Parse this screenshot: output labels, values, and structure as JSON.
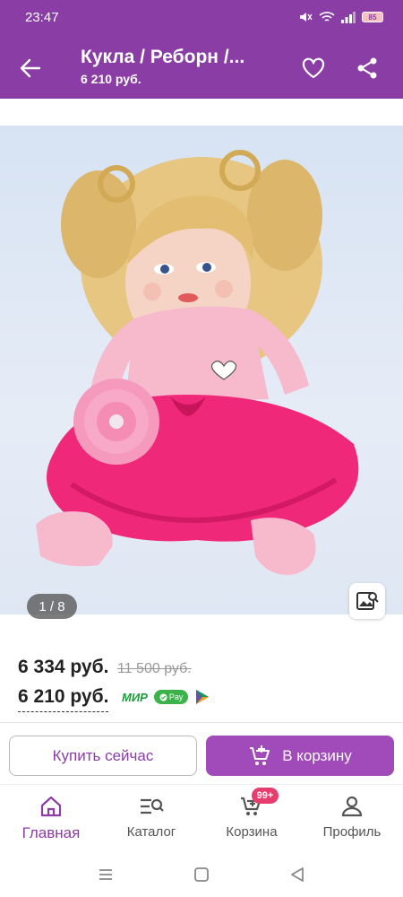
{
  "status_bar": {
    "time": "23:47",
    "battery": "85"
  },
  "header": {
    "title": "Кукла / Реборн /...",
    "subtitle": "6 210 руб."
  },
  "gallery": {
    "counter": "1 / 8"
  },
  "prices": {
    "main": "6 334 руб.",
    "old": "11 500 руб.",
    "card": "6 210 руб.",
    "mir": "МИР",
    "pay_label": "Pay"
  },
  "actions": {
    "buy_now": "Купить сейчас",
    "add_to_cart": "В корзину"
  },
  "nav": {
    "items": [
      {
        "label": "Главная",
        "icon": "home-icon"
      },
      {
        "label": "Каталог",
        "icon": "catalog-search-icon"
      },
      {
        "label": "Корзина",
        "icon": "cart-icon"
      },
      {
        "label": "Профиль",
        "icon": "profile-icon"
      }
    ],
    "cart_badge": "99+"
  },
  "colors": {
    "brand": "#8a3da4",
    "button": "#a14ab9",
    "badge": "#e63d6e"
  }
}
